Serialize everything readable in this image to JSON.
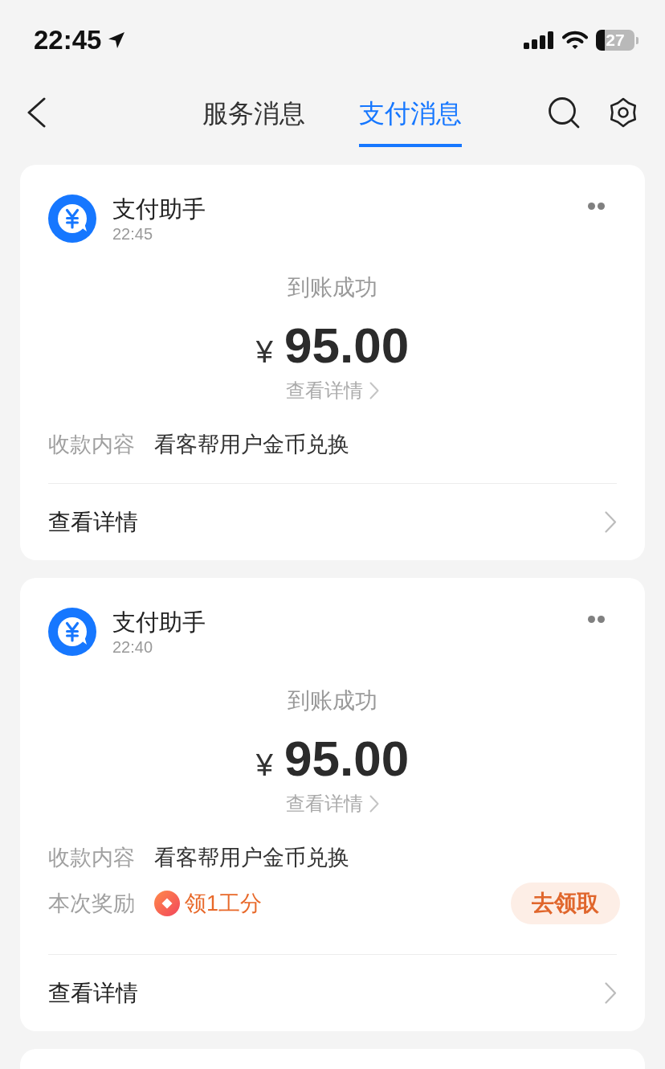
{
  "status_bar": {
    "time": "22:45",
    "battery": "27"
  },
  "nav": {
    "tabs": [
      {
        "label": "服务消息",
        "selected": false
      },
      {
        "label": "支付消息",
        "selected": true
      }
    ]
  },
  "messages": [
    {
      "sender": "支付助手",
      "time": "22:45",
      "status": "到账成功",
      "currency": "¥",
      "amount": "95.00",
      "amount_link": "查看详情",
      "fields": [
        {
          "kind": "text",
          "label": "收款内容",
          "value": "看客帮用户金币兑换"
        }
      ],
      "footer_link": "查看详情"
    },
    {
      "sender": "支付助手",
      "time": "22:40",
      "status": "到账成功",
      "currency": "¥",
      "amount": "95.00",
      "amount_link": "查看详情",
      "fields": [
        {
          "kind": "text",
          "label": "收款内容",
          "value": "看客帮用户金币兑换"
        },
        {
          "kind": "reward",
          "label": "本次奖励",
          "value": "领1工分",
          "action": "去领取"
        }
      ],
      "footer_link": "查看详情"
    }
  ]
}
